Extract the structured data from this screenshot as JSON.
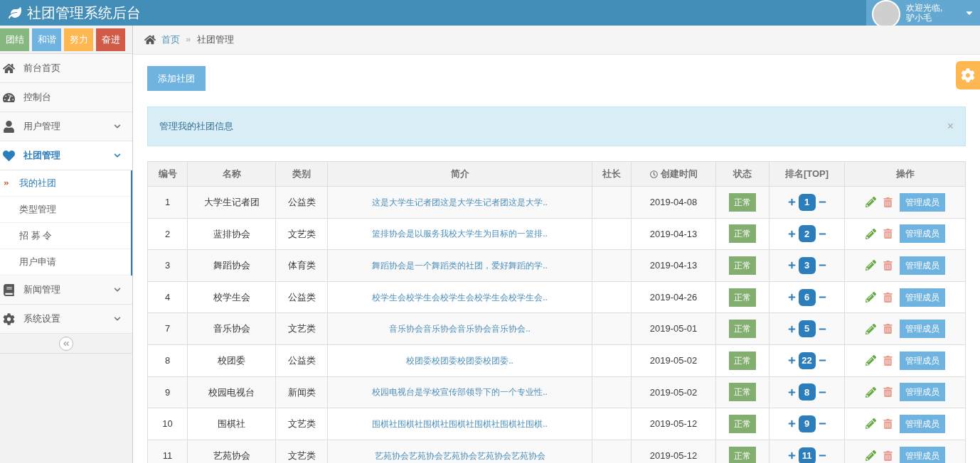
{
  "navbar": {
    "title": "社团管理系统后台",
    "user": {
      "greeting": "欢迎光临,",
      "name": "驴小毛"
    }
  },
  "sidebar": {
    "shortcuts": [
      {
        "label": "团结",
        "color": "#87b87f"
      },
      {
        "label": "和谐",
        "color": "#6fb3e0"
      },
      {
        "label": "努力",
        "color": "#ffb752"
      },
      {
        "label": "奋进",
        "color": "#d15b47"
      }
    ],
    "items": [
      {
        "label": "前台首页",
        "selected": false
      },
      {
        "label": "控制台",
        "selected": false
      },
      {
        "label": "用户管理",
        "selected": false,
        "expanded": false
      },
      {
        "label": "社团管理",
        "selected": true,
        "expanded": true,
        "children": [
          {
            "label": "我的社团",
            "selected": true
          },
          {
            "label": "类型管理",
            "selected": false
          },
          {
            "label": "招 募 令",
            "selected": false
          },
          {
            "label": "用户申请",
            "selected": false
          }
        ]
      },
      {
        "label": "新闻管理",
        "selected": false,
        "expanded": false
      },
      {
        "label": "系统设置",
        "selected": false,
        "expanded": false
      }
    ]
  },
  "breadcrumb": [
    "首页",
    "社团管理"
  ],
  "add_button": "添加社团",
  "alert": {
    "text": "管理我的社团信息",
    "close": "×"
  },
  "table": {
    "columns": [
      "编号",
      "名称",
      "类别",
      "简介",
      "社长",
      "创建时间",
      "状态",
      "排名[TOP]",
      "操作"
    ],
    "rows": [
      {
        "id": "1",
        "name": "大学生记者团",
        "category": "公益类",
        "intro": "这是大学生记者团这是大学生记者团这是大学..",
        "leader": "",
        "created": "2019-04-08",
        "status": "正常",
        "rank": "1",
        "action": "管理成员"
      },
      {
        "id": "2",
        "name": "蓝排协会",
        "category": "文艺类",
        "intro": "篮排协会是以服务我校大学生为目标的一篮排..",
        "leader": "",
        "created": "2019-04-13",
        "status": "正常",
        "rank": "2",
        "action": "管理成员"
      },
      {
        "id": "3",
        "name": "舞蹈协会",
        "category": "体育类",
        "intro": "舞蹈协会是一个舞蹈类的社团，爱好舞蹈的学..",
        "leader": "",
        "created": "2019-04-13",
        "status": "正常",
        "rank": "3",
        "action": "管理成员"
      },
      {
        "id": "4",
        "name": "校学生会",
        "category": "公益类",
        "intro": "校学生会校学生会校学生会校学生会校学生会..",
        "leader": "",
        "created": "2019-04-26",
        "status": "正常",
        "rank": "6",
        "action": "管理成员"
      },
      {
        "id": "7",
        "name": "音乐协会",
        "category": "文艺类",
        "intro": "音乐协会音乐协会音乐协会音乐协会..",
        "leader": "",
        "created": "2019-05-01",
        "status": "正常",
        "rank": "5",
        "action": "管理成员"
      },
      {
        "id": "8",
        "name": "校团委",
        "category": "公益类",
        "intro": "校团委校团委校团委校团委..",
        "leader": "",
        "created": "2019-05-02",
        "status": "正常",
        "rank": "22",
        "action": "管理成员"
      },
      {
        "id": "9",
        "name": "校园电视台",
        "category": "新闻类",
        "intro": "校园电视台是学校宣传部领导下的一个专业性..",
        "leader": "",
        "created": "2019-05-02",
        "status": "正常",
        "rank": "8",
        "action": "管理成员"
      },
      {
        "id": "10",
        "name": "围棋社",
        "category": "文艺类",
        "intro": "围棋社围棋社围棋社围棋社围棋社围棋社围棋..",
        "leader": "",
        "created": "2019-05-12",
        "status": "正常",
        "rank": "9",
        "action": "管理成员"
      },
      {
        "id": "11",
        "name": "艺苑协会",
        "category": "文艺类",
        "intro": "艺苑协会艺苑协会艺苑协会艺苑协会艺苑协会",
        "leader": "",
        "created": "2019-05-12",
        "status": "正常",
        "rank": "11",
        "action": "管理成员"
      }
    ]
  }
}
